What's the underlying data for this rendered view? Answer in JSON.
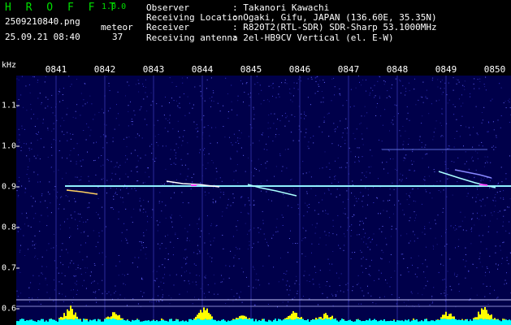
{
  "header": {
    "app_name": "H R O F F T",
    "version": "1.0.0",
    "filename": "2509210840.png",
    "timestamp": "25.09.21 08:40",
    "meteor_label": "meteor",
    "meteor_count": "37",
    "info": [
      {
        "key": "Observer",
        "value": ": Takanori Kawachi"
      },
      {
        "key": "Receiving Location",
        "value": ": Ogaki, Gifu, JAPAN (136.60E, 35.35N)"
      },
      {
        "key": "Receiver",
        "value": ": R820T2(RTL-SDR) SDR-Sharp 53.1000MHz"
      },
      {
        "key": "Receiving antenna",
        "value": ": 2el-HB9CV Vertical (el. E-W)"
      }
    ]
  },
  "axis": {
    "unit": "kHz",
    "time_labels": [
      "0841",
      "0842",
      "0843",
      "0844",
      "0845",
      "0846",
      "0847",
      "0848",
      "0849",
      "0850"
    ],
    "freq_labels": [
      "1.1",
      "1.0",
      "0.9",
      "0.8",
      "0.7",
      "0.6"
    ]
  },
  "colors": {
    "background": "#00004a",
    "carrier": "#8ff0ff",
    "meteor": "#ff40ff",
    "spectrum_high": "#ffff00",
    "spectrum_low": "#00ffff"
  }
}
